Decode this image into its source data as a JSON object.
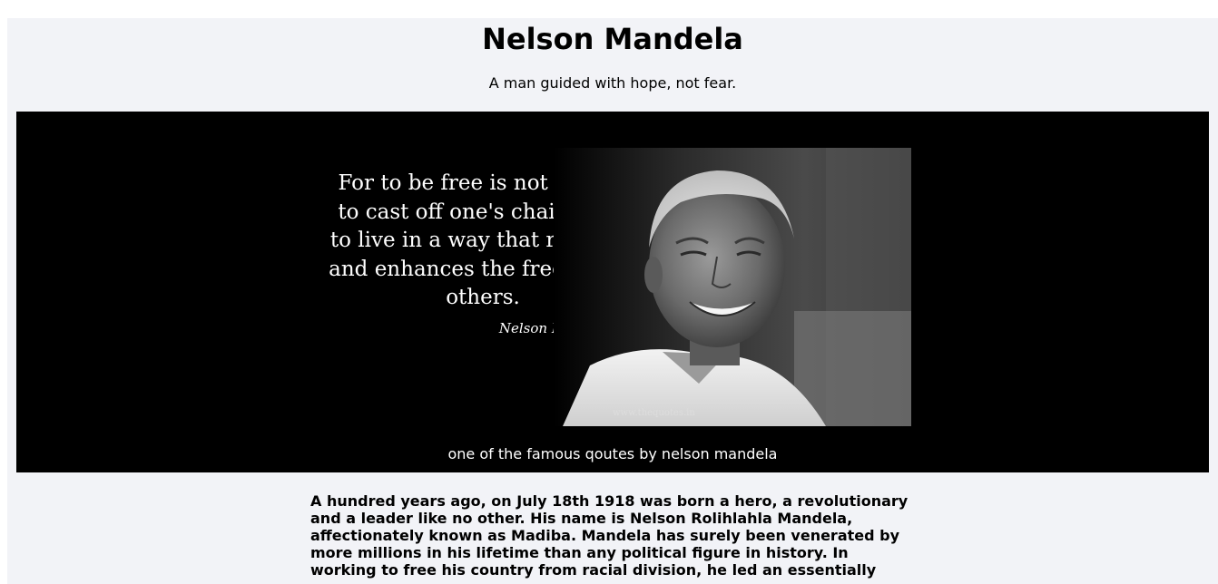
{
  "header": {
    "title": "Nelson Mandela",
    "tagline": "A man guided with hope, not fear."
  },
  "figure": {
    "quote_lines": [
      "For to be free is not merely",
      "to cast off one's chains, but",
      "to live in a way that respects",
      "and enhances the freedom of",
      "others."
    ],
    "quote_author": "Nelson Mandela",
    "watermark": "www.thequotes.in",
    "caption": "one of the famous qoutes by nelson mandela"
  },
  "biography": {
    "text": "A hundred years ago, on July 18th 1918 was born a hero, a revolutionary and a leader like no other. His name is Nelson Rolihlahla Mandela, affectionately known as Madiba. Mandela has surely been venerated by more millions in his lifetime than any political figure in history. In working to free his country from racial division, he led an essentially"
  },
  "colors": {
    "page_background": "#f2f3f7",
    "figure_background": "#000000",
    "caption_text": "#ffffff"
  }
}
